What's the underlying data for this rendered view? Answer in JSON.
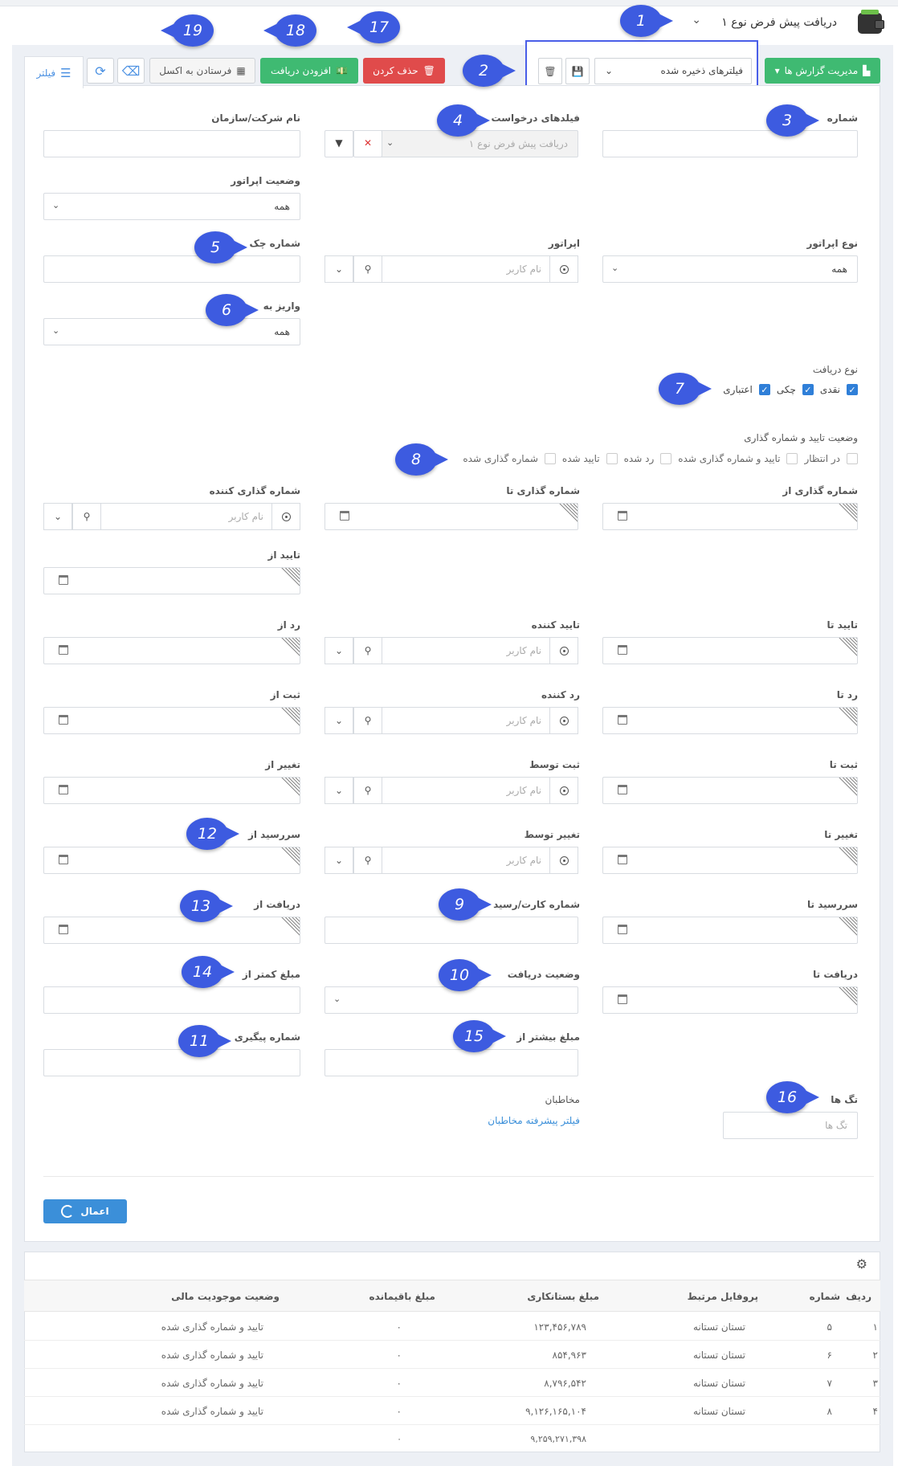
{
  "header": {
    "title": "دریافت پیش فرض نوع ۱",
    "dropdown_icon": "chevron-down-icon",
    "app_icon": "wallet-icon"
  },
  "toolbar": {
    "reports_label": "مدیریت گزارش ها",
    "saved_filters_placeholder": "فیلترهای ذخیره شده",
    "delete_label": "حذف کردن",
    "add_label": "افزودن دریافت",
    "excel_label": "فرستادن به اکسل",
    "filter_tab_label": "فیلتر"
  },
  "form": {
    "number_label": "شماره",
    "request_fields_label": "فیلدهای درخواست",
    "request_fields_value": "دریافت پیش فرض نوع ۱",
    "company_label": "نام شرکت/سازمان",
    "operator_status_label": "وضعیت اپراتور",
    "operator_status_value": "همه",
    "operator_type_label": "نوع اپراتور",
    "operator_type_value": "همه",
    "operator_label": "اپراتور",
    "username_placeholder": "نام کاربر",
    "check_number_label": "شماره چک",
    "deposit_to_label": "واریز به",
    "deposit_to_value": "همه",
    "receipt_type_label": "نوع دریافت",
    "receipt_types": [
      "نقدی",
      "چکی",
      "اعتباری"
    ],
    "approval_status_label": "وضعیت تایید و شماره گذاری",
    "approval_statuses": [
      "در انتظار",
      "تایید و شماره گذاری شده",
      "رد شده",
      "تایید شده",
      "شماره گذاری شده"
    ],
    "numbering_from_label": "شماره گذاری از",
    "numbering_to_label": "شماره گذاری تا",
    "numberer_label": "شماره گذاری کننده",
    "approve_from_label": "تایید از",
    "approve_to_label": "تایید تا",
    "approver_label": "تایید کننده",
    "reject_from_label": "رد از",
    "reject_to_label": "رد تا",
    "rejecter_label": "رد کننده",
    "register_from_label": "ثبت از",
    "register_to_label": "ثبت تا",
    "registered_by_label": "ثبت توسط",
    "change_from_label": "تغییر از",
    "change_to_label": "تغییر تا",
    "changed_by_label": "تغییر توسط",
    "due_from_label": "سررسید از",
    "due_to_label": "سررسید تا",
    "card_receipt_label": "شماره کارت/رسید",
    "receipt_from_label": "دریافت از",
    "receipt_to_label": "دریافت تا",
    "receipt_status_label": "وضعیت دریافت",
    "amount_less_label": "مبلغ کمتر از",
    "amount_more_label": "مبلغ بیشتر از",
    "tracking_label": "شماره پیگیری",
    "tags_label": "تگ ها",
    "tags_placeholder": "تگ ها",
    "contacts_label": "مخاطبان",
    "contacts_link": "فیلتر پیشرفته مخاطبان",
    "apply_label": "اعمال"
  },
  "badges": [
    "1",
    "2",
    "3",
    "4",
    "5",
    "6",
    "7",
    "8",
    "9",
    "10",
    "11",
    "12",
    "13",
    "14",
    "15",
    "16",
    "17",
    "18",
    "19"
  ],
  "table": {
    "columns": [
      "ردیف",
      "شماره",
      "پروفایل مرتبط",
      "مبلغ بستانکاری",
      "مبلغ باقیمانده",
      "وضعیت موجودیت مالی"
    ],
    "rows": [
      [
        "۱",
        "۵",
        "تستان تستانه",
        "۱۲۳,۴۵۶,۷۸۹",
        "۰",
        "تایید و شماره گذاری شده"
      ],
      [
        "۲",
        "۶",
        "تستان تستانه",
        "۸۵۴,۹۶۳",
        "۰",
        "تایید و شماره گذاری شده"
      ],
      [
        "۳",
        "۷",
        "تستان تستانه",
        "۸,۷۹۶,۵۴۲",
        "۰",
        "تایید و شماره گذاری شده"
      ],
      [
        "۴",
        "۸",
        "تستان تستانه",
        "۹,۱۲۶,۱۶۵,۱۰۴",
        "۰",
        "تایید و شماره گذاری شده"
      ]
    ],
    "total_amount": "۹,۲۵۹,۲۷۱,۳۹۸",
    "total_remaining": "۰"
  },
  "colors": {
    "green": "#3fba72",
    "red": "#e04b4b",
    "blue": "#3b8fd9",
    "badge": "#3d5be0"
  }
}
